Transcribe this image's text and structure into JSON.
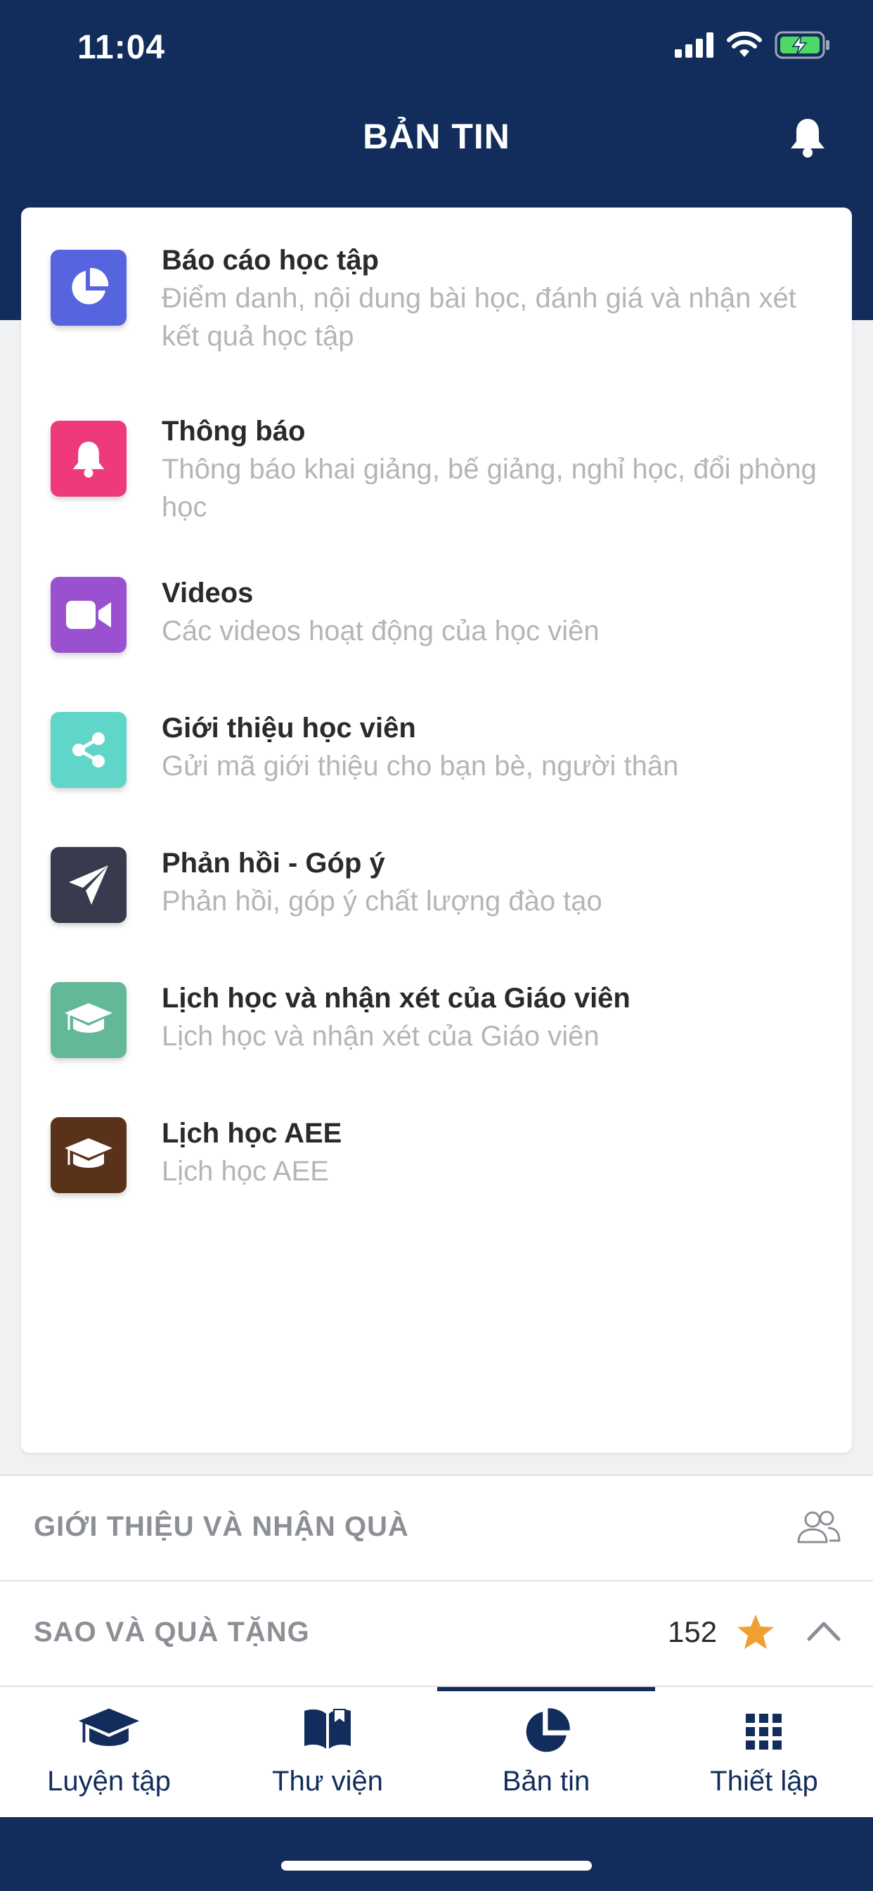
{
  "status_bar": {
    "time": "11:04"
  },
  "header": {
    "title": "BẢN TIN"
  },
  "menu": [
    {
      "title": "Báo cáo học tập",
      "subtitle": "Điểm danh, nội dung bài học, đánh giá và nhận xét kết quả học tập",
      "icon": "pie-chart-icon",
      "color": "#5664e0"
    },
    {
      "title": "Thông báo",
      "subtitle": "Thông báo khai giảng, bế giảng, nghỉ học, đổi phòng học",
      "icon": "bell-icon",
      "color": "#ee3a7a"
    },
    {
      "title": "Videos",
      "subtitle": "Các videos hoạt động của học viên",
      "icon": "video-camera-icon",
      "color": "#9a51d0"
    },
    {
      "title": "Giới thiệu học viên",
      "subtitle": "Gửi mã giới thiệu cho bạn bè, người thân",
      "icon": "share-icon",
      "color": "#5fd6c8"
    },
    {
      "title": "Phản hồi - Góp ý",
      "subtitle": "Phản hồi, góp ý chất lượng đào tạo",
      "icon": "paper-plane-icon",
      "color": "#383b4d"
    },
    {
      "title": "Lịch học và nhận xét của Giáo viên",
      "subtitle": "Lịch học và nhận xét của Giáo viên",
      "icon": "graduation-cap-icon",
      "color": "#63b897"
    },
    {
      "title": "Lịch học AEE",
      "subtitle": "Lịch học AEE",
      "icon": "graduation-cap-icon",
      "color": "#5a3219"
    }
  ],
  "referral": {
    "label": "GIỚI THIỆU VÀ NHẬN QUÀ",
    "icon": "users-icon"
  },
  "stars": {
    "label": "SAO VÀ QUÀ TẶNG",
    "count": "152",
    "icon": "star-icon",
    "star_color": "#f0a030"
  },
  "tabs": [
    {
      "label": "Luyện tập",
      "icon": "graduation-cap-icon"
    },
    {
      "label": "Thư viện",
      "icon": "book-icon"
    },
    {
      "label": "Bản tin",
      "icon": "pie-chart-icon",
      "active": true
    },
    {
      "label": "Thiết lập",
      "icon": "grid-icon"
    }
  ],
  "colors": {
    "primary": "#122d5c",
    "background": "#f0f1f3"
  }
}
